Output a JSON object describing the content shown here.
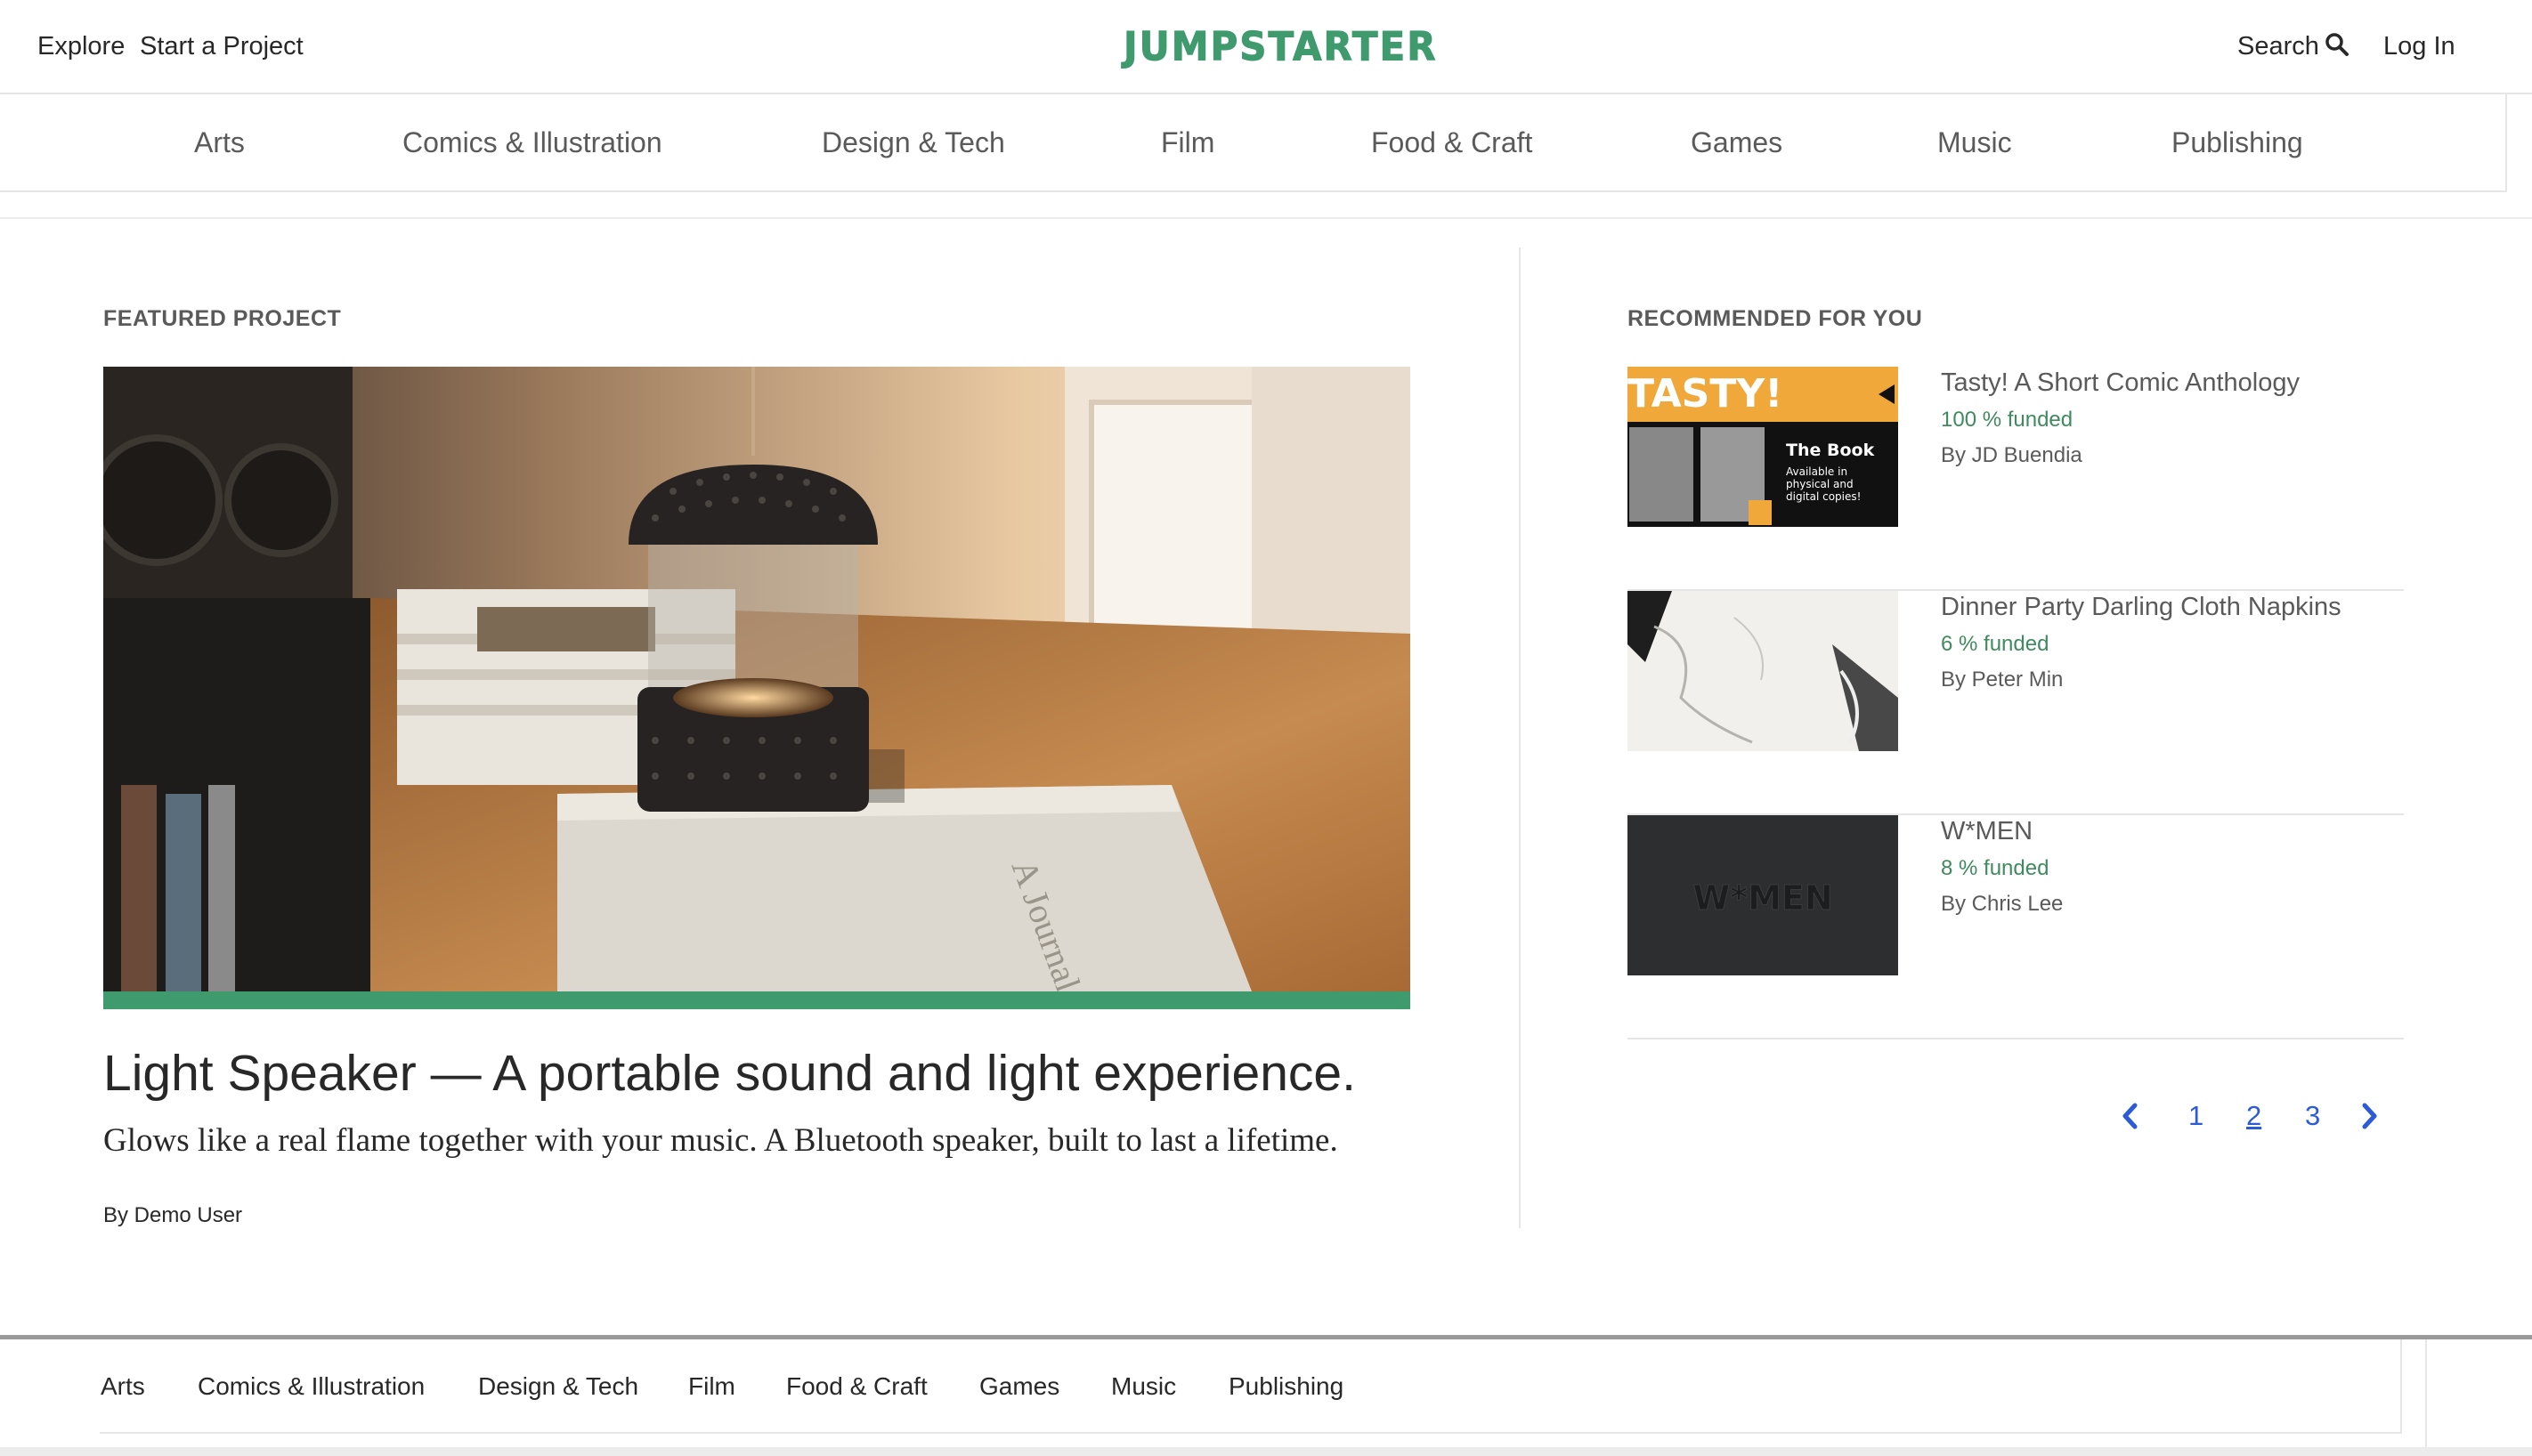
{
  "header": {
    "explore": "Explore",
    "start_project": "Start a Project",
    "logo": "JUMPSTARTER",
    "search": "Search",
    "login": "Log In"
  },
  "categories": [
    "Arts",
    "Comics & Illustration",
    "Design & Tech",
    "Film",
    "Food & Craft",
    "Games",
    "Music",
    "Publishing"
  ],
  "featured": {
    "heading": "FEATURED PROJECT",
    "title": "Light Speaker — A portable sound and light experience.",
    "blurb": "Glows like a real flame together with your music. A Bluetooth speaker, built to last a lifetime.",
    "author": "By Demo User",
    "progress": 1.0
  },
  "recommended": {
    "heading": "RECOMMENDED FOR YOU",
    "items": [
      {
        "title": "Tasty! A Short Comic Anthology",
        "funded": "100 % funded",
        "author": "By JD Buendia",
        "thumb": {
          "banner": "TASTY!",
          "book": "The Book",
          "sub1": "Available in",
          "sub2": "physical and",
          "sub3": "digital copies!"
        }
      },
      {
        "title": "Dinner Party Darling Cloth Napkins",
        "funded": "6 % funded",
        "author": "By Peter Min"
      },
      {
        "title": "W*MEN",
        "funded": "8 % funded",
        "author": "By Chris Lee",
        "thumb": {
          "text": "W*MEN"
        }
      }
    ]
  },
  "pagination": {
    "pages": [
      "1",
      "2",
      "3"
    ],
    "current": "2"
  },
  "footer": {
    "categories": [
      "Arts",
      "Comics & Illustration",
      "Design & Tech",
      "Film",
      "Food & Craft",
      "Games",
      "Music",
      "Publishing"
    ]
  },
  "colors": {
    "brand_green": "#3f9a6e",
    "link_blue": "#2d5bd8"
  }
}
